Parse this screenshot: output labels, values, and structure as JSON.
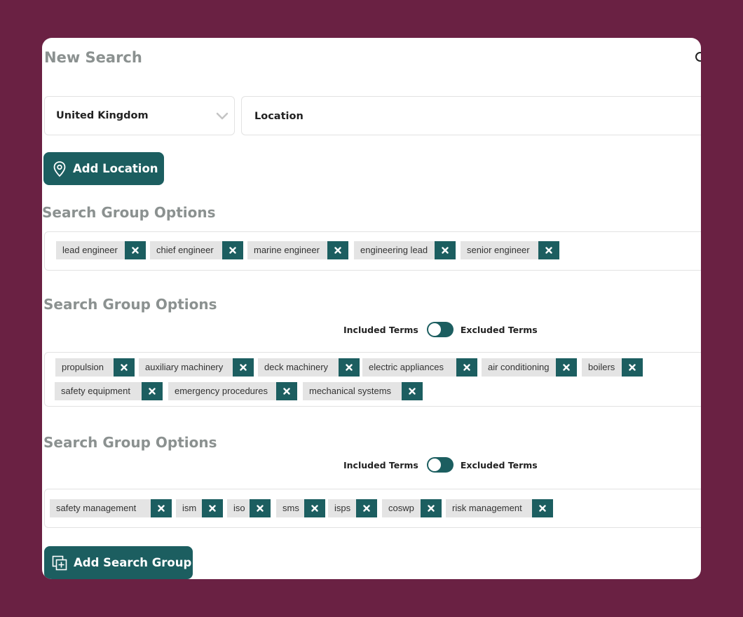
{
  "header": {
    "title": "New Search"
  },
  "location": {
    "country_value": "United  Kingdom",
    "location_placeholder": "Location",
    "add_location_label": "Add Location"
  },
  "toggle": {
    "included_label": "Included Terms",
    "excluded_label": "Excluded Terms"
  },
  "groups": [
    {
      "title": "Search Group Options",
      "tags": [
        "lead engineer",
        "chief engineer",
        "marine engineer",
        "engineering lead",
        "senior engineer"
      ]
    },
    {
      "title": "Search Group Options",
      "tags": [
        "propulsion",
        "auxiliary machinery",
        "deck machinery",
        "electric appliances",
        "air conditioning",
        "boilers",
        "safety equipment",
        "emergency procedures",
        "mechanical systems"
      ]
    },
    {
      "title": "Search Group Options",
      "tags": [
        "safety management",
        "ism",
        "iso",
        "sms",
        "isps",
        "coswp",
        "risk management"
      ]
    }
  ],
  "add_group_label": "Add Search Group",
  "colors": {
    "accent": "#1c5e60",
    "background": "#6a2143",
    "tag_bg": "#e4e4e4",
    "heading": "#8b9190"
  },
  "icons": {
    "location_button": "map-pin-icon",
    "add_group_button": "add-layer-icon",
    "tag_remove": "close-icon",
    "select": "chevron-down-icon"
  }
}
